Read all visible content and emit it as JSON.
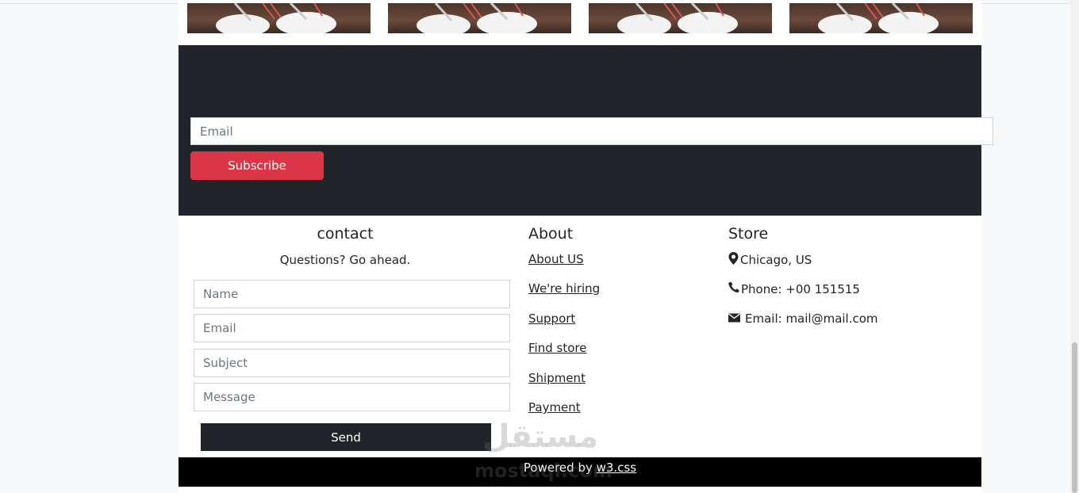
{
  "newsletter": {
    "email_placeholder": "Email",
    "subscribe_label": "Subscribe"
  },
  "contact": {
    "heading": "contact",
    "subtitle": "Questions? Go ahead.",
    "name_placeholder": "Name",
    "email_placeholder": "Email",
    "subject_placeholder": "Subject",
    "message_placeholder": "Message",
    "send_label": "Send"
  },
  "about": {
    "heading": "About",
    "links": [
      "About US",
      "We're hiring",
      "Support",
      "Find store",
      "Shipment",
      "Payment"
    ]
  },
  "store": {
    "heading": "Store",
    "location": "Chicago, US",
    "phone": "Phone: +00 151515",
    "email": "Email: mail@mail.com",
    "icons": [
      "map-marker-icon",
      "phone-icon",
      "envelope-icon"
    ]
  },
  "footer": {
    "powered_prefix": "Powered by ",
    "powered_link": "w3.css"
  },
  "watermark": {
    "arabic": "مستقل",
    "latin": "mostaql.com"
  },
  "colors": {
    "dark": "#212529",
    "accent": "#dc3545",
    "footer": "#000000"
  }
}
